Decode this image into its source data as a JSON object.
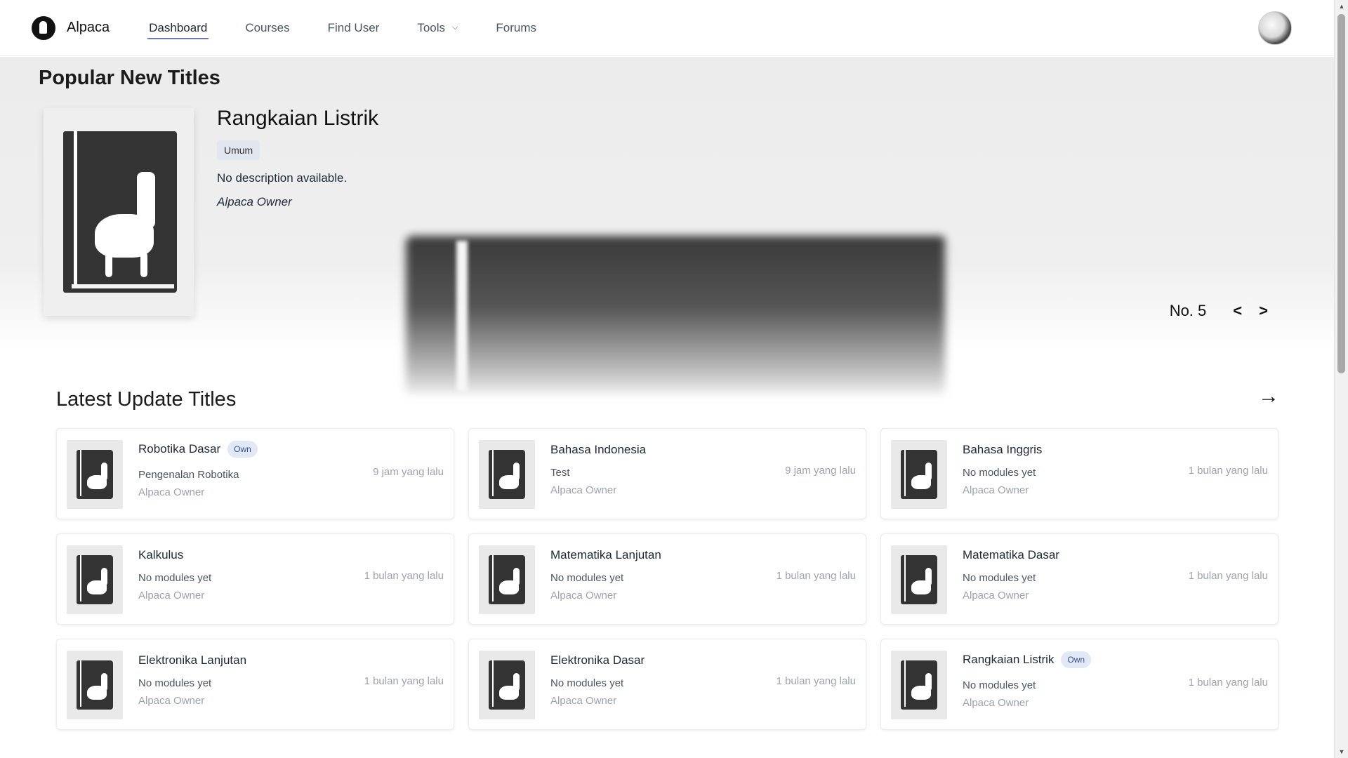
{
  "navbar": {
    "brand": "Alpaca",
    "links": [
      {
        "label": "Dashboard",
        "active": true
      },
      {
        "label": "Courses"
      },
      {
        "label": "Find User"
      },
      {
        "label": "Tools",
        "dropdown": true
      },
      {
        "label": "Forums"
      }
    ],
    "icons": {
      "logo": "alpaca-logo",
      "dropdown": "chevron-down-icon",
      "avatar": "user-avatar"
    }
  },
  "hero": {
    "heading": "Popular New Titles",
    "featured": {
      "title": "Rangkaian Listrik",
      "tag": "Umum",
      "description": "No description available.",
      "owner": "Alpaca Owner"
    },
    "position": "No. 5",
    "prev": "<",
    "next": ">"
  },
  "latest": {
    "heading": "Latest Update Titles",
    "more_icon": "arrow-right-icon",
    "more_glyph": "→",
    "cards": [
      {
        "title": "Robotika Dasar",
        "badge": "Own",
        "subtitle": "Pengenalan Robotika",
        "owner": "Alpaca Owner",
        "time": "9 jam yang lalu"
      },
      {
        "title": "Bahasa Indonesia",
        "badge": "",
        "subtitle": "Test",
        "owner": "Alpaca Owner",
        "time": "9 jam yang lalu"
      },
      {
        "title": "Bahasa Inggris",
        "badge": "",
        "subtitle": "No modules yet",
        "owner": "Alpaca Owner",
        "time": "1 bulan yang lalu"
      },
      {
        "title": "Kalkulus",
        "badge": "",
        "subtitle": "No modules yet",
        "owner": "Alpaca Owner",
        "time": "1 bulan yang lalu"
      },
      {
        "title": "Matematika Lanjutan",
        "badge": "",
        "subtitle": "No modules yet",
        "owner": "Alpaca Owner",
        "time": "1 bulan yang lalu"
      },
      {
        "title": "Matematika Dasar",
        "badge": "",
        "subtitle": "No modules yet",
        "owner": "Alpaca Owner",
        "time": "1 bulan yang lalu"
      },
      {
        "title": "Elektronika Lanjutan",
        "badge": "",
        "subtitle": "No modules yet",
        "owner": "Alpaca Owner",
        "time": "1 bulan yang lalu"
      },
      {
        "title": "Elektronika Dasar",
        "badge": "",
        "subtitle": "No modules yet",
        "owner": "Alpaca Owner",
        "time": "1 bulan yang lalu"
      },
      {
        "title": "Rangkaian Listrik",
        "badge": "Own",
        "subtitle": "No modules yet",
        "owner": "Alpaca Owner",
        "time": "1 bulan yang lalu"
      }
    ]
  },
  "colors": {
    "accent_underline": "#6b7bb7",
    "badge_bg": "#e1e8f6",
    "badge_text": "#35508f",
    "hero_bg": "#ececec",
    "book": "#333333"
  }
}
